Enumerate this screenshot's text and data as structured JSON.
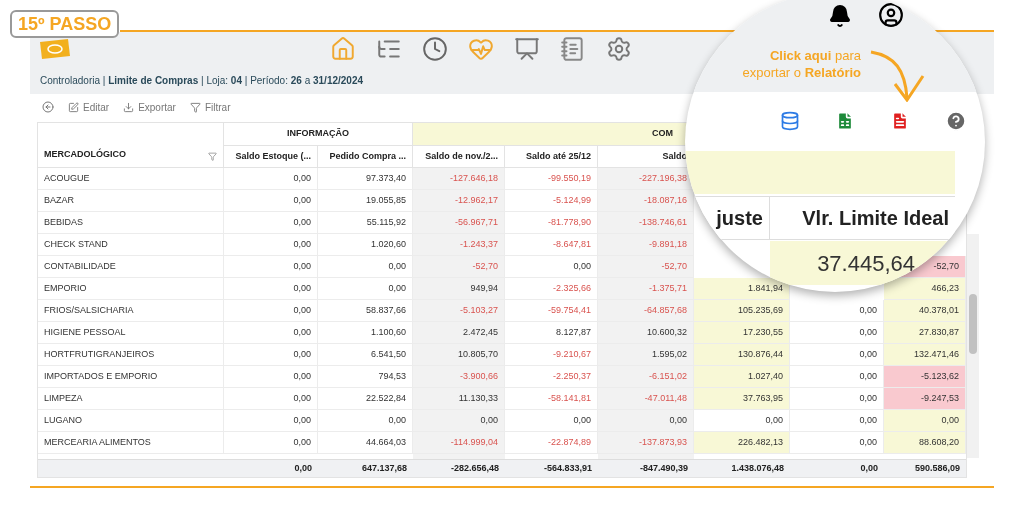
{
  "step_badge": "15º PASSO",
  "breadcrumb": "Controladoria | **Limite de Compras** | Loja: **04** | Período: **26** a **31/12/2024**",
  "toolbar": [
    "Editar",
    "Exportar",
    "Filtrar"
  ],
  "callout": "**Click aqui** para exportar o **Relatório**",
  "magnified": {
    "headers": [
      "juste",
      "Vlr. Limite Ideal"
    ],
    "value": "37.445,64"
  },
  "table": {
    "groups": [
      {
        "columns": [
          {
            "label": "MERCADOLÓGICO",
            "filter": true
          }
        ]
      },
      {
        "label": "INFORMAÇÃO",
        "highlight": false,
        "columns": [
          {
            "label": "Saldo Estoque (..."
          },
          {
            "label": "Pedido Compra ..."
          }
        ]
      },
      {
        "label": "COM",
        "highlight": true,
        "columns": [
          {
            "label": "Saldo de nov./2..."
          },
          {
            "label": "Saldo até 25/12"
          },
          {
            "label": "Saldo"
          },
          {},
          {},
          {}
        ]
      }
    ],
    "rows": [
      {
        "name": "ACOUGUE",
        "cells": [
          {
            "text": "0,00"
          },
          {
            "text": "97.373,40"
          },
          {
            "text": "-127.646,18",
            "negative": true
          },
          {
            "text": "-99.550,19",
            "negative": true
          },
          {
            "text": "-227.196,38",
            "negative": true
          },
          null,
          null,
          null
        ]
      },
      {
        "name": "BAZAR",
        "cells": [
          {
            "text": "0,00"
          },
          {
            "text": "19.055,85"
          },
          {
            "text": "-12.962,17",
            "negative": true
          },
          {
            "text": "-5.124,99",
            "negative": true
          },
          {
            "text": "-18.087,16",
            "negative": true
          },
          null,
          null,
          null
        ]
      },
      {
        "name": "BEBIDAS",
        "cells": [
          {
            "text": "0,00"
          },
          {
            "text": "55.115,92"
          },
          {
            "text": "-56.967,71",
            "negative": true
          },
          {
            "text": "-81.778,90",
            "negative": true
          },
          {
            "text": "-138.746,61",
            "negative": true
          },
          null,
          null,
          null
        ]
      },
      {
        "name": "CHECK STAND",
        "cells": [
          {
            "text": "0,00"
          },
          {
            "text": "1.020,60"
          },
          {
            "text": "-1.243,37",
            "negative": true
          },
          {
            "text": "-8.647,81",
            "negative": true
          },
          {
            "text": "-9.891,18",
            "negative": true
          },
          null,
          null,
          null
        ]
      },
      {
        "name": "CONTABILIDADE",
        "cells": [
          {
            "text": "0,00"
          },
          {
            "text": "0,00"
          },
          {
            "text": "-52,70",
            "negative": true
          },
          {
            "text": "0,00"
          },
          {
            "text": "-52,70",
            "negative": true
          },
          null,
          null,
          {
            "text": "-52,70",
            "alert": true
          }
        ]
      },
      {
        "name": "EMPORIO",
        "cells": [
          {
            "text": "0,00"
          },
          {
            "text": "0,00"
          },
          {
            "text": "949,94"
          },
          {
            "text": "-2.325,66",
            "negative": true
          },
          {
            "text": "-1.375,71",
            "negative": true
          },
          {
            "text": "1.841,94",
            "highlight": true
          },
          null,
          {
            "text": "466,23",
            "highlight": true
          }
        ]
      },
      {
        "name": "FRIOS/SALSICHARIA",
        "cells": [
          {
            "text": "0,00"
          },
          {
            "text": "58.837,66"
          },
          {
            "text": "-5.103,27",
            "negative": true
          },
          {
            "text": "-59.754,41",
            "negative": true
          },
          {
            "text": "-64.857,68",
            "negative": true
          },
          {
            "text": "105.235,69",
            "highlight": true
          },
          {
            "text": "0,00"
          },
          {
            "text": "40.378,01",
            "highlight": true
          }
        ]
      },
      {
        "name": "HIGIENE PESSOAL",
        "cells": [
          {
            "text": "0,00"
          },
          {
            "text": "1.100,60"
          },
          {
            "text": "2.472,45"
          },
          {
            "text": "8.127,87"
          },
          {
            "text": "10.600,32"
          },
          {
            "text": "17.230,55",
            "highlight": true
          },
          {
            "text": "0,00"
          },
          {
            "text": "27.830,87",
            "highlight": true
          }
        ]
      },
      {
        "name": "HORTFRUTIGRANJEIROS",
        "cells": [
          {
            "text": "0,00"
          },
          {
            "text": "6.541,50"
          },
          {
            "text": "10.805,70"
          },
          {
            "text": "-9.210,67",
            "negative": true
          },
          {
            "text": "1.595,02"
          },
          {
            "text": "130.876,44",
            "highlight": true
          },
          {
            "text": "0,00"
          },
          {
            "text": "132.471,46",
            "highlight": true
          }
        ]
      },
      {
        "name": "IMPORTADOS E EMPORIO",
        "cells": [
          {
            "text": "0,00"
          },
          {
            "text": "794,53"
          },
          {
            "text": "-3.900,66",
            "negative": true
          },
          {
            "text": "-2.250,37",
            "negative": true
          },
          {
            "text": "-6.151,02",
            "negative": true
          },
          {
            "text": "1.027,40",
            "highlight": true
          },
          {
            "text": "0,00"
          },
          {
            "text": "-5.123,62",
            "alert": true
          }
        ]
      },
      {
        "name": "LIMPEZA",
        "cells": [
          {
            "text": "0,00"
          },
          {
            "text": "22.522,84"
          },
          {
            "text": "11.130,33"
          },
          {
            "text": "-58.141,81",
            "negative": true
          },
          {
            "text": "-47.011,48",
            "negative": true
          },
          {
            "text": "37.763,95",
            "highlight": true
          },
          {
            "text": "0,00"
          },
          {
            "text": "-9.247,53",
            "alert": true
          }
        ]
      },
      {
        "name": "LUGANO",
        "cells": [
          {
            "text": "0,00"
          },
          {
            "text": "0,00"
          },
          {
            "text": "0,00"
          },
          {
            "text": "0,00"
          },
          {
            "text": "0,00"
          },
          {
            "text": "0,00"
          },
          {
            "text": "0,00"
          },
          {
            "text": "0,00",
            "highlight": true
          }
        ]
      },
      {
        "name": "MERCEARIA ALIMENTOS",
        "cells": [
          {
            "text": "0,00"
          },
          {
            "text": "44.664,03"
          },
          {
            "text": "-114.999,04",
            "negative": true
          },
          {
            "text": "-22.874,89",
            "negative": true
          },
          {
            "text": "-137.873,93",
            "negative": true
          },
          {
            "text": "226.482,13",
            "highlight": true
          },
          {
            "text": "0,00"
          },
          {
            "text": "88.608,20",
            "highlight": true
          }
        ]
      }
    ],
    "totals": [
      "0,00",
      "647.137,68",
      "-282.656,48",
      "-564.833,91",
      "-847.490,39",
      "1.438.076,48",
      "0,00",
      "590.586,09"
    ]
  }
}
